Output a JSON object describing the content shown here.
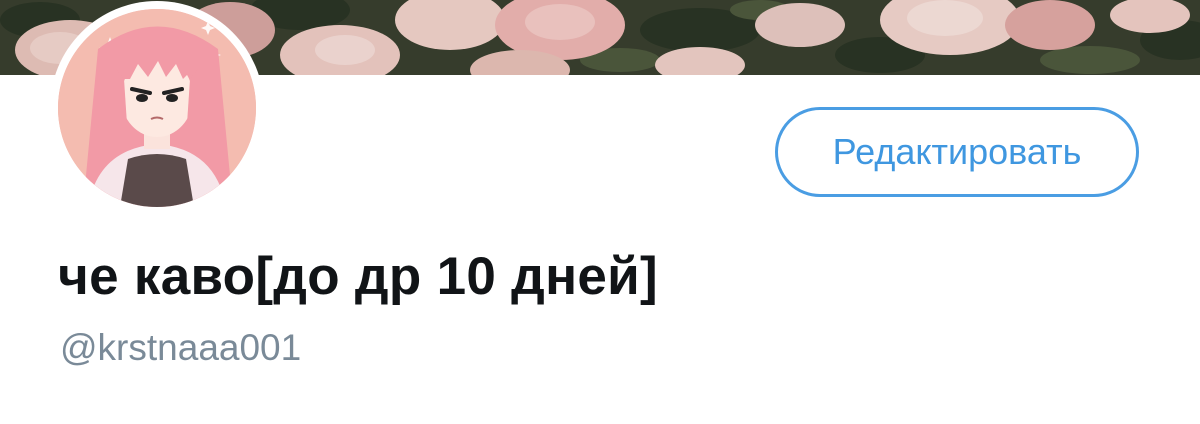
{
  "profile": {
    "edit_label": "Редактировать",
    "display_name": "че каво[до др 10 дней]",
    "handle": "@krstnaaa001"
  },
  "colors": {
    "accent": "#4a9de3",
    "name_text": "#111417",
    "handle_text": "#7a8a98",
    "banner_rose": "#f0c4be",
    "banner_leaf": "#2f3a27"
  },
  "icons": {
    "banner": "pink-roses-banner-image",
    "avatar": "anime-girl-pink-hair-avatar"
  }
}
